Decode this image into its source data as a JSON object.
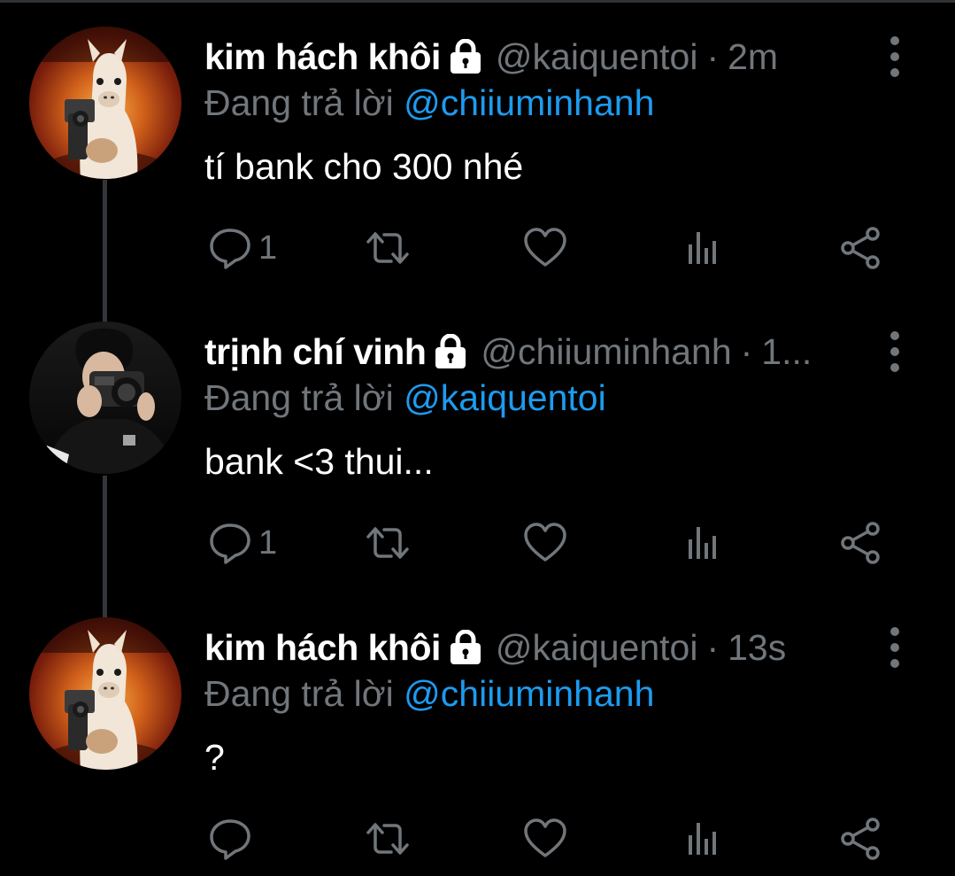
{
  "theme": {
    "background": "#000000",
    "text": "#ffffff",
    "muted": "#71767b",
    "accent": "#1d9bf0",
    "thread_line": "#333639"
  },
  "tweets": [
    {
      "name": "kim hách khôi",
      "handle": "@kaiquentoi",
      "separator": "·",
      "time": "2m",
      "reply_prefix": "Đang trả lời",
      "reply_to": "@chiiuminhanh",
      "text": "tí bank cho 300 nhé",
      "reply_count": "1",
      "avatar": "llama-with-gun-avatar",
      "protected_icon": "lock-icon"
    },
    {
      "name": "trịnh chí vinh",
      "handle": "@chiiuminhanh",
      "separator": "·",
      "time": "1...",
      "reply_prefix": "Đang trả lời",
      "reply_to": "@kaiquentoi",
      "text": "bank <3 thui...",
      "reply_count": "1",
      "avatar": "person-with-camera-avatar",
      "protected_icon": "lock-icon"
    },
    {
      "name": "kim hách khôi",
      "handle": "@kaiquentoi",
      "separator": "·",
      "time": "13s",
      "reply_prefix": "Đang trả lời",
      "reply_to": "@chiiuminhanh",
      "text": "?",
      "reply_count": "",
      "avatar": "llama-with-gun-avatar",
      "protected_icon": "lock-icon"
    }
  ],
  "action_icons": [
    "reply-icon",
    "retweet-icon",
    "like-icon",
    "views-icon",
    "share-icon"
  ]
}
